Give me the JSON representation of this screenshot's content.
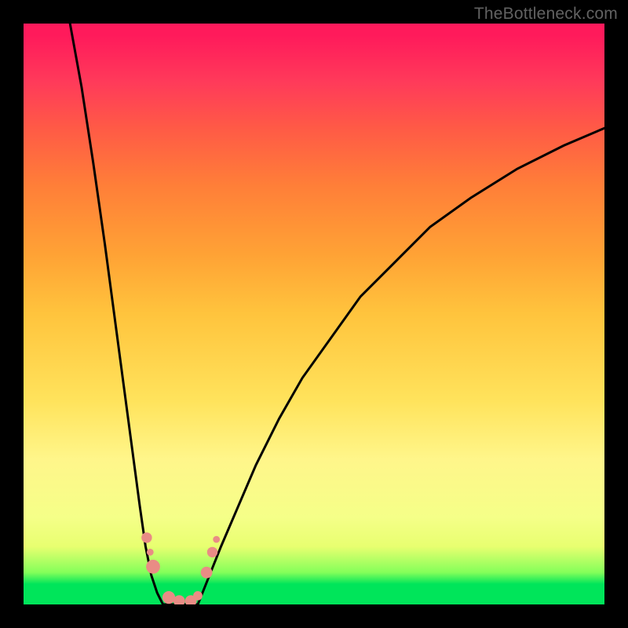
{
  "watermark": "TheBottleneck.com",
  "palette": {
    "bg_frame": "#000000",
    "gradient_top": "#ff1a5b",
    "gradient_mid": "#ffd24a",
    "gradient_bottom": "#00e55a",
    "curve_stroke": "#000000",
    "dot_fill": "#e98c85"
  },
  "chart_data": {
    "type": "line",
    "title": "",
    "xlabel": "",
    "ylabel": "",
    "xlim": [
      0,
      100
    ],
    "ylim": [
      0,
      100
    ],
    "series": [
      {
        "name": "left-branch",
        "x": [
          8,
          10,
          12,
          14,
          16,
          18,
          20,
          21,
          22,
          23,
          24
        ],
        "y": [
          100,
          89,
          76,
          62,
          47,
          32,
          17,
          10,
          5,
          2,
          0
        ]
      },
      {
        "name": "valley-floor",
        "x": [
          24,
          25,
          26,
          27,
          28,
          29,
          30
        ],
        "y": [
          0,
          0,
          0,
          0,
          0,
          0,
          0
        ]
      },
      {
        "name": "right-branch",
        "x": [
          30,
          32,
          34,
          37,
          40,
          44,
          48,
          53,
          58,
          64,
          70,
          77,
          85,
          93,
          100
        ],
        "y": [
          0,
          5,
          10,
          17,
          24,
          32,
          39,
          46,
          53,
          59,
          65,
          70,
          75,
          79,
          82
        ]
      }
    ],
    "markers": [
      {
        "name": "dot-left-wall-upper",
        "x": 21.2,
        "y": 11.5,
        "r": 0.9
      },
      {
        "name": "dot-left-wall-lower",
        "x": 22.3,
        "y": 6.5,
        "r": 1.2
      },
      {
        "name": "dot-left-wall-tiny",
        "x": 21.8,
        "y": 9.0,
        "r": 0.6
      },
      {
        "name": "dot-valley-left",
        "x": 25.0,
        "y": 1.2,
        "r": 1.1
      },
      {
        "name": "dot-valley-mid1",
        "x": 26.8,
        "y": 0.6,
        "r": 1.0
      },
      {
        "name": "dot-valley-mid2",
        "x": 28.8,
        "y": 0.6,
        "r": 1.0
      },
      {
        "name": "dot-valley-right",
        "x": 30.0,
        "y": 1.5,
        "r": 0.8
      },
      {
        "name": "dot-right-wall-lower",
        "x": 31.5,
        "y": 5.5,
        "r": 1.0
      },
      {
        "name": "dot-right-wall-upper",
        "x": 32.5,
        "y": 9.0,
        "r": 0.9
      },
      {
        "name": "dot-right-wall-tiny",
        "x": 33.2,
        "y": 11.2,
        "r": 0.6
      }
    ]
  }
}
